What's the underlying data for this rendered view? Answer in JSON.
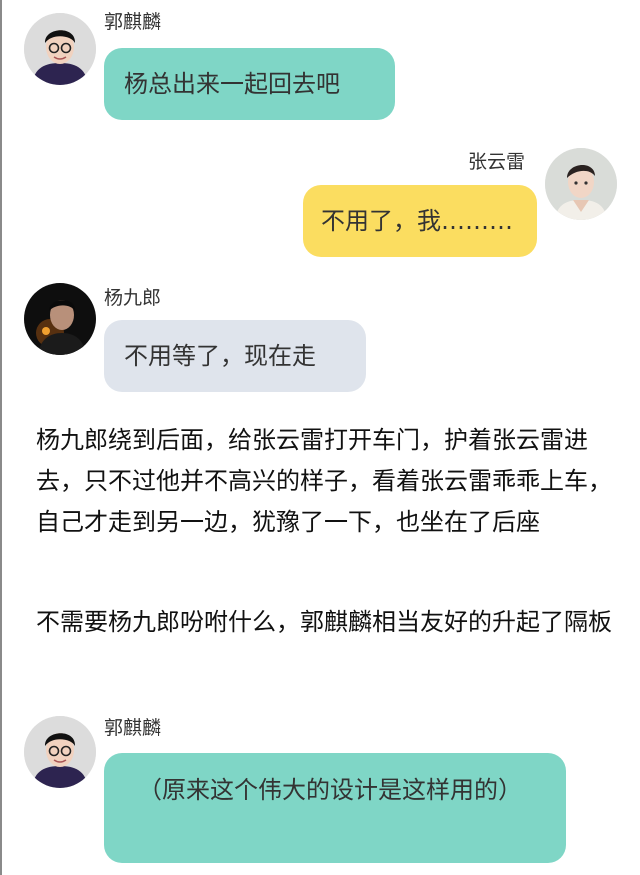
{
  "messages": [
    {
      "sender": "郭麒麟",
      "text": "杨总出来一起回去吧",
      "side": "left",
      "bubble_color": "#7fd6c6",
      "avatar": "guo-qilin-avatar"
    },
    {
      "sender": "张云雷",
      "text": "不用了，我………",
      "side": "right",
      "bubble_color": "#fbdd60",
      "avatar": "zhang-yunlei-avatar"
    },
    {
      "sender": "杨九郎",
      "text": "不用等了，现在走",
      "side": "left",
      "bubble_color": "#dfe4ec",
      "avatar": "yang-jiulang-avatar"
    }
  ],
  "narration": [
    "杨九郎绕到后面，给张云雷打开车门，护着张云雷进去，只不过他并不高兴的样子，看着张云雷乖乖上车，自己才走到另一边，犹豫了一下，也坐在了后座",
    "不需要杨九郎吩咐什么，郭麒麟相当友好的升起了隔板"
  ],
  "last_message": {
    "sender": "郭麒麟",
    "text": "（原来这个伟大的设计是这样用的）",
    "side": "left",
    "bubble_color": "#7fd6c6",
    "avatar": "guo-qilin-avatar"
  }
}
